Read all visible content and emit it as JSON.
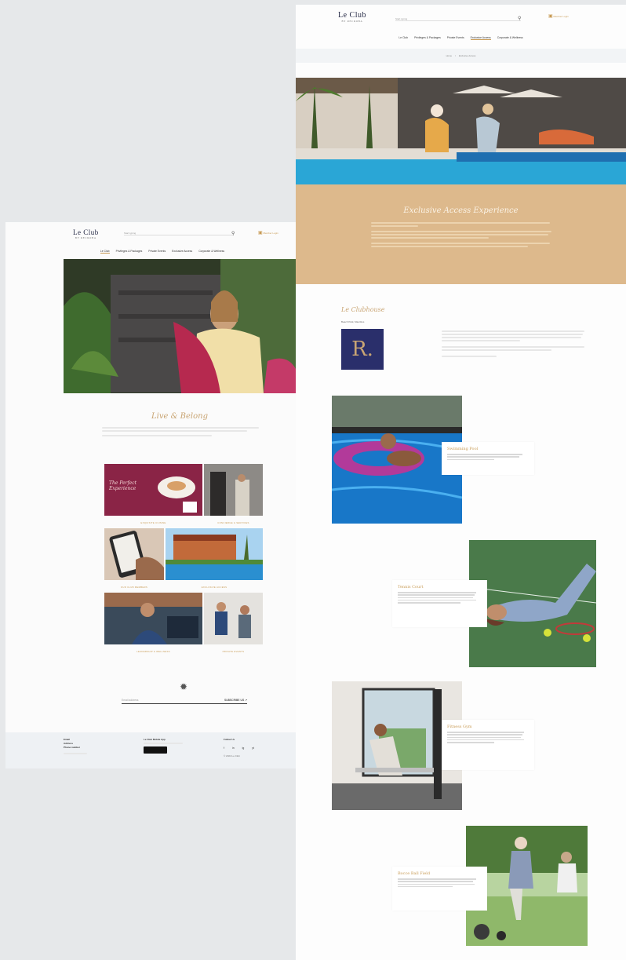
{
  "brand": {
    "name": "Le Club",
    "tagline": "BY RECROBA"
  },
  "left_page": {
    "search_placeholder": "Start typing",
    "login": "Member Login",
    "nav": [
      "Le Club",
      "Privileges & Packages",
      "Private Events",
      "Exclusive Access",
      "Corporate & Wellness"
    ],
    "active_nav": 0,
    "section_title": "Live & Belong",
    "tiles": [
      {
        "caption": "EXQUISITE CUISINE",
        "art_text": "The Perfect Experience"
      },
      {
        "caption": "CONCIERGE & SERVICES"
      },
      {
        "caption": "OUR CLUB MEMBERS"
      },
      {
        "caption": "EXCLUSIVE ACCESS"
      },
      {
        "caption": "LEADERSHIP & WELLNESS"
      },
      {
        "caption": "PRIVATE EVENTS"
      }
    ],
    "newsletter": {
      "placeholder": "Email address",
      "button": "SUBSCRIBE US"
    },
    "footer": {
      "email_label": "Email",
      "address_label": "Address",
      "phone_label": "Phone number",
      "app_heading": "Le Club Mobile App",
      "follow": "Follow Us",
      "copyright": "© 2024 Le Club",
      "social": [
        "f",
        "in",
        "ig",
        "yt"
      ]
    }
  },
  "right_page": {
    "search_placeholder": "Start typing",
    "login": "Member Login",
    "nav": [
      "Le Club",
      "Privileges & Packages",
      "Private Events",
      "Exclusive Access",
      "Corporate & Wellness"
    ],
    "active_nav": 3,
    "breadcrumb": [
      "Home",
      "Exclusive Access"
    ],
    "banner_title": "Exclusive Access Experience",
    "clubhouse_title": "Le Clubhouse",
    "clubhouse_sub": "Beach Park, Mauritius",
    "clubhouse_logo": "R.",
    "features": [
      {
        "title": "Swimming Pool"
      },
      {
        "title": "Tennis Court"
      },
      {
        "title": "Fitness Gym"
      },
      {
        "title": "Bocce Ball Field"
      }
    ]
  },
  "colors": {
    "accent": "#c89b55",
    "sand": "#ddb98c",
    "navy": "#2a2f6b"
  }
}
